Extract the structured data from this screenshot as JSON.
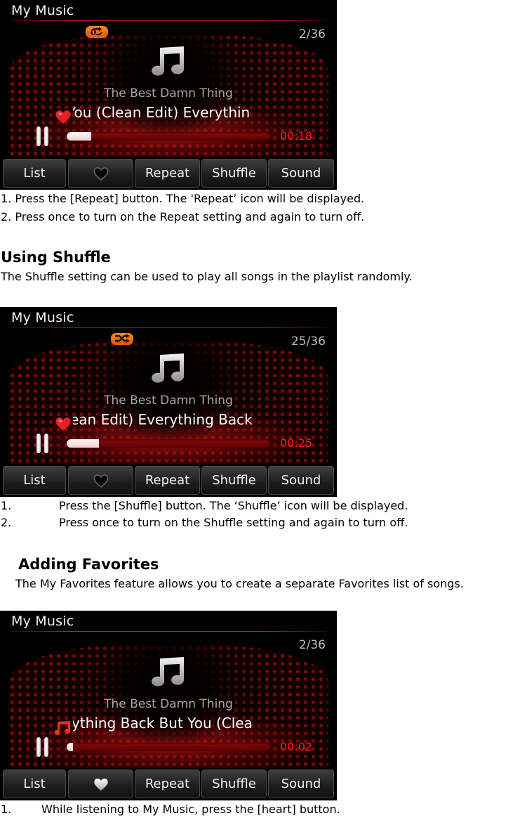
{
  "repeat_section": {
    "screen": {
      "title": "My Music",
      "mode_icon": "repeat-one-icon",
      "track_count": "2/36",
      "album": "The Best Damn Thing",
      "song_visible": "You (Clean Edit) Everythin",
      "song_prefix_icon": "favorite-heart-icon",
      "elapsed": "00:18",
      "progress_percent": 12,
      "buttons": [
        "List",
        "",
        "Repeat",
        "Shuffle",
        "Sound"
      ],
      "heart_button_state": "dark"
    },
    "steps": [
      "1. Press the [Repeat] button. The 'Repeat’ icon will be displayed.",
      "2. Press once to turn on the Repeat setting and again to turn off."
    ]
  },
  "shuffle_section": {
    "heading": "Using Shuffle",
    "description": "The Shuffle setting can be used to play all songs in the playlist randomly.",
    "screen": {
      "title": "My Music",
      "mode_icon": "shuffle-icon",
      "track_count": "25/36",
      "album": "The Best Damn Thing",
      "song_visible": "ean Edit) Everything Back",
      "song_prefix_icon": "favorite-heart-icon",
      "elapsed": "00:25",
      "progress_percent": 16,
      "buttons": [
        "List",
        "",
        "Repeat",
        "Shuffle",
        "Sound"
      ],
      "heart_button_state": "dark"
    },
    "steps": [
      {
        "num": "1.",
        "text": "Press the [Shuffle] button. The ‘Shuffle’ icon will be displayed."
      },
      {
        "num": "2.",
        "text": "Press once to turn on the Shuffle setting and again to turn off."
      }
    ]
  },
  "favorites_section": {
    "heading": "Adding Favorites",
    "description": "The My Favorites feature allows you to create a separate Favorites list of songs.",
    "screen": {
      "title": "My Music",
      "track_count": "2/36",
      "album": "The Best Damn Thing",
      "song_visible": "ything Back But You (Clea",
      "song_prefix_icon": "music-note-icon",
      "elapsed": "00:02",
      "progress_percent": 3,
      "buttons": [
        "List",
        "",
        "Repeat",
        "Shuffle",
        "Sound"
      ],
      "heart_button_state": "light"
    },
    "steps": [
      {
        "num": "1.",
        "text": "While listening to My Music, press the [heart] button."
      }
    ]
  },
  "colors": {
    "accent_red": "#ff1a1a",
    "mode_orange": "#ff8a1a",
    "screen_bg": "#000000"
  }
}
